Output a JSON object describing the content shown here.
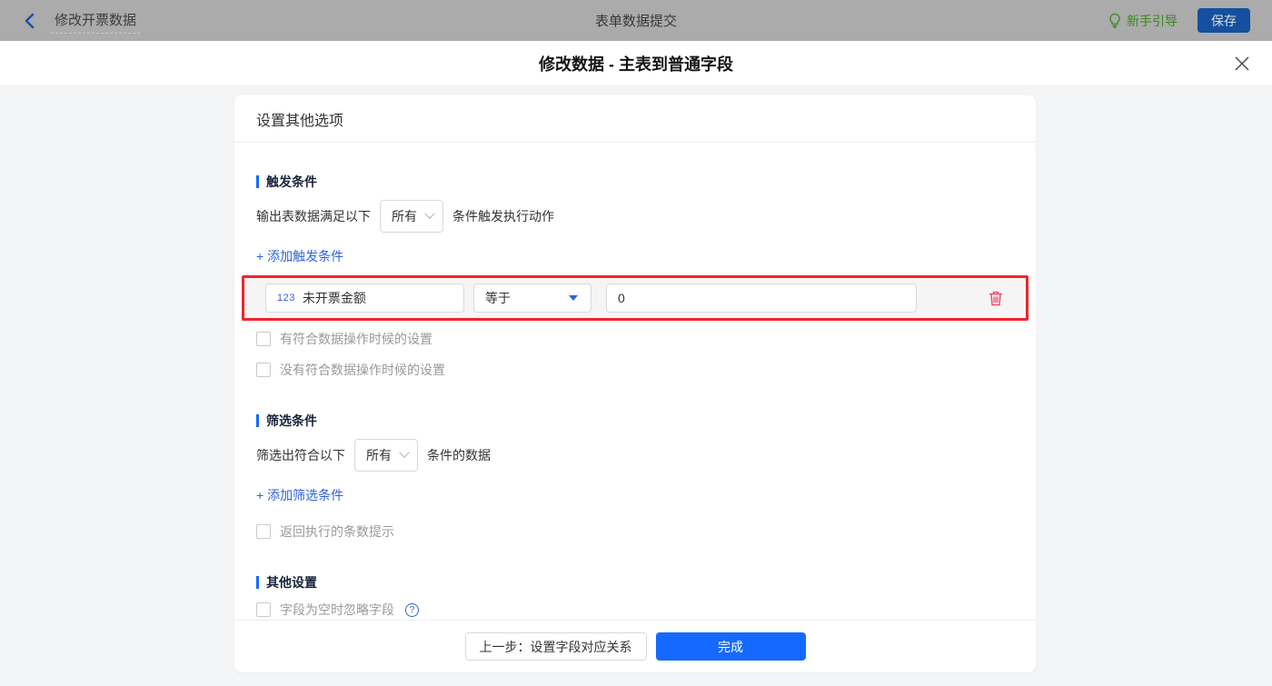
{
  "topbar": {
    "back_label": "修改开票数据",
    "center_title": "表单数据提交",
    "guide_label": "新手引导",
    "save_label": "保存"
  },
  "modal": {
    "title": "修改数据 - 主表到普通字段",
    "panel_header": "设置其他选项"
  },
  "trigger_section": {
    "title": "触发条件",
    "sentence_prefix": "输出表数据满足以下",
    "match_select_value": "所有",
    "sentence_suffix": "条件触发执行动作",
    "add_link": "+ 添加触发条件",
    "condition": {
      "field_type_badge": "123",
      "field_name": "未开票金额",
      "operator": "等于",
      "value": "0"
    },
    "checkbox_has_match": "有符合数据操作时候的设置",
    "checkbox_no_match": "没有符合数据操作时候的设置"
  },
  "filter_section": {
    "title": "筛选条件",
    "sentence_prefix": "筛选出符合以下",
    "match_select_value": "所有",
    "sentence_suffix": "条件的数据",
    "add_link": "+ 添加筛选条件",
    "checkbox_return_count": "返回执行的条数提示"
  },
  "other_section": {
    "title": "其他设置",
    "checkbox_ignore_empty": "字段为空时忽略字段",
    "help_glyph": "?"
  },
  "footer": {
    "prev_label": "上一步：设置字段对应关系",
    "done_label": "完成"
  },
  "colors": {
    "accent_blue": "#1669ff",
    "link_blue": "#2e63d9",
    "highlight_red": "#f5222d",
    "trash_red": "#f5455c",
    "guide_green": "#37871c"
  }
}
